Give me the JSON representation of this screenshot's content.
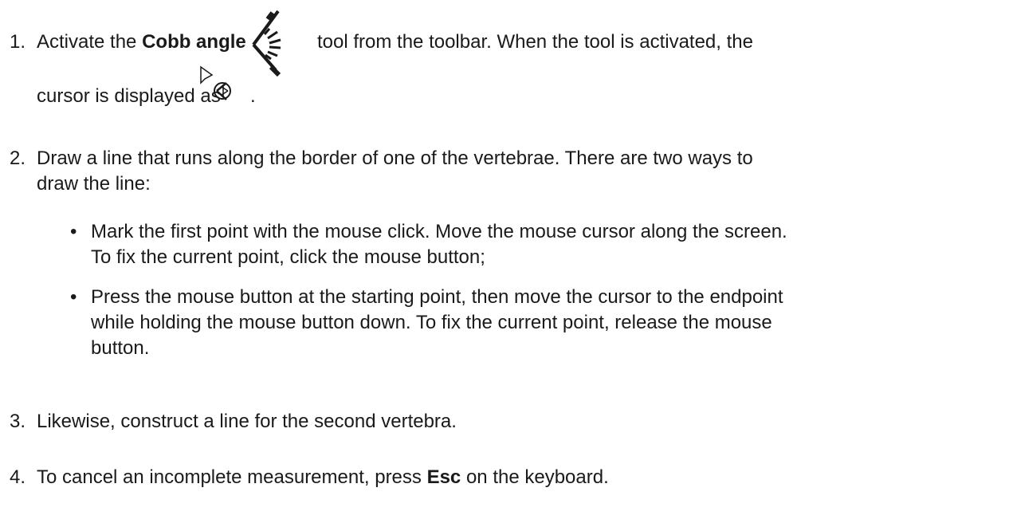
{
  "steps": [
    {
      "number": "1.",
      "text_before_bold": "Activate the ",
      "bold": "Cobb angle",
      "text_after_icon": "tool from the toolbar. When the tool is activated, the",
      "line2_before_icon": "cursor is displayed as",
      "line2_after_icon": "."
    },
    {
      "number": "2.",
      "line1": "Draw a line that runs along the border of one of the vertebrae. There are two ways to",
      "line2": "draw the line:",
      "bullets": [
        {
          "marker": "•",
          "line1": "Mark the first point with the mouse click. Move the mouse cursor along the screen.",
          "line2": "To fix the current point, click the mouse button;"
        },
        {
          "marker": "•",
          "line1": "Press the mouse button at the starting point, then move the cursor to the endpoint",
          "line2": "while holding the mouse button down. To fix the current point, release the mouse",
          "line3": "button."
        }
      ]
    },
    {
      "number": "3.",
      "text": "Likewise, construct a line for the second vertebra."
    },
    {
      "number": "4.",
      "text_before_bold": "To cancel an incomplete measurement, press ",
      "bold": "Esc",
      "text_after_bold": " on the keyboard."
    }
  ],
  "icons": {
    "toolbar": "cobb-angle-icon",
    "cursor": "cobb-angle-cursor-icon"
  }
}
